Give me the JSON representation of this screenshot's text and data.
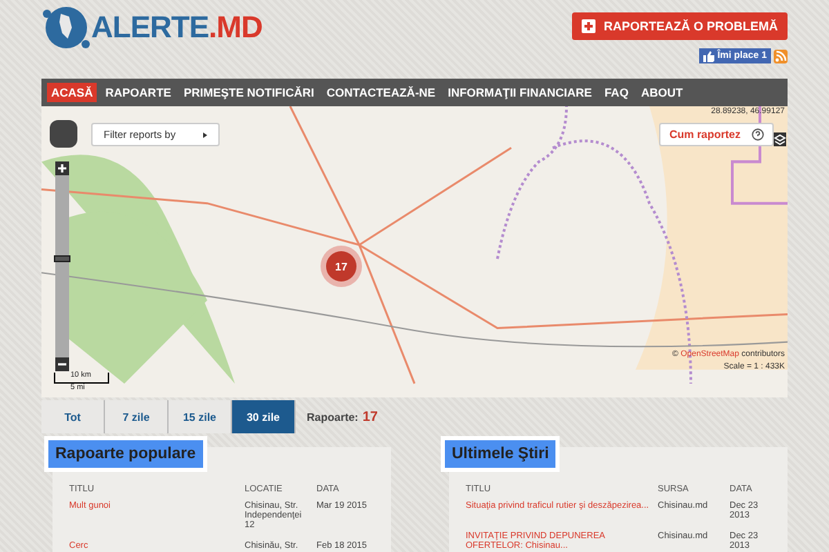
{
  "logo": {
    "main": "ALERTE",
    "suffix": ".MD"
  },
  "report_button": {
    "label": "RAPORTEAZĂ O PROBLEMĂ"
  },
  "like_button": {
    "label": "Îmi place 1"
  },
  "nav": [
    {
      "label": "ACASĂ",
      "selected": true
    },
    {
      "label": "RAPOARTE",
      "selected": false
    },
    {
      "label": "PRIMEŞTE NOTIFICĂRI",
      "selected": false
    },
    {
      "label": "CONTACTEAZĂ-NE",
      "selected": false
    },
    {
      "label": "INFORMAŢII FINANCIARE",
      "selected": false
    },
    {
      "label": "FAQ",
      "selected": false
    },
    {
      "label": "ABOUT",
      "selected": false
    }
  ],
  "map": {
    "coordinates": "28.89238, 46.99127",
    "filter_button": "Filter reports by",
    "help_button": "Cum raportez",
    "cluster_count": "17",
    "zoom_slider": {
      "level": 0.55
    },
    "scale_km": "10 km",
    "scale_mi": "5 mi",
    "scale_ratio": "Scale = 1 : 433K",
    "attribution_prefix": "©",
    "attribution_link": "OpenStreetMap",
    "attribution_suffix": "contributors"
  },
  "period_tabs": [
    {
      "label": "Tot",
      "selected": false
    },
    {
      "label": "7 zile",
      "selected": false
    },
    {
      "label": "15 zile",
      "selected": false
    },
    {
      "label": "30 zile",
      "selected": true
    }
  ],
  "report_count": {
    "label": "Rapoarte:",
    "value": "17"
  },
  "popular": {
    "title": "Rapoarte populare",
    "columns": [
      "TITLU",
      "LOCATIE",
      "DATA"
    ],
    "rows": [
      [
        "Mult gunoi",
        "Chisinau, Str. Independenţei 12",
        "Mar 19 2015"
      ],
      [
        "Cerc",
        "Chisinău, Str.",
        "Feb 18 2015"
      ]
    ]
  },
  "news": {
    "title": "Ultimele Ştiri",
    "columns": [
      "TITLU",
      "SURSA",
      "DATA"
    ],
    "rows": [
      [
        "Situaţia privind traficul rutier şi deszăpezirea...",
        "Chisinau.md",
        "Dec 23 2013"
      ],
      [
        "INVITAŢIE PRIVIND DEPUNEREA OFERTELOR: Chisinau...",
        "Chisinau.md",
        "Dec 23 2013"
      ]
    ]
  }
}
